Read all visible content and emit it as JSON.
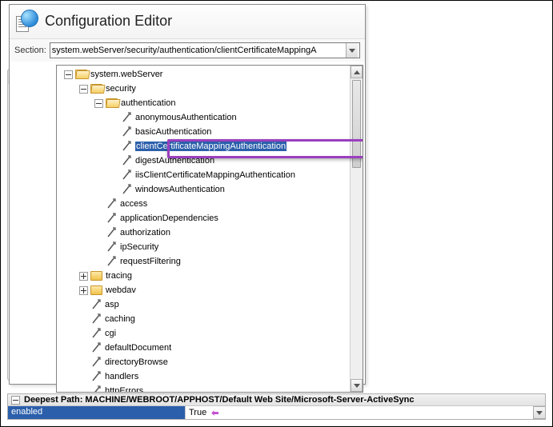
{
  "bg": {
    "title": "Deep",
    "row": "enable"
  },
  "header": {
    "title": "Configuration Editor"
  },
  "section": {
    "label": "Section:",
    "value": "system.webServer/security/authentication/clientCertificateMappingA"
  },
  "tree": [
    {
      "depth": 0,
      "exp": "minus",
      "icon": "folder-open",
      "label": "system.webServer"
    },
    {
      "depth": 1,
      "exp": "minus",
      "icon": "folder-open",
      "label": "security"
    },
    {
      "depth": 2,
      "exp": "minus",
      "icon": "folder-open",
      "label": "authentication"
    },
    {
      "depth": 3,
      "exp": "none",
      "icon": "leaf",
      "label": "anonymousAuthentication"
    },
    {
      "depth": 3,
      "exp": "none",
      "icon": "leaf",
      "label": "basicAuthentication"
    },
    {
      "depth": 3,
      "exp": "none",
      "icon": "leaf",
      "label": "clientCertificateMappingAuthentication",
      "selected": true
    },
    {
      "depth": 3,
      "exp": "none",
      "icon": "leaf",
      "label": "digestAuthentication"
    },
    {
      "depth": 3,
      "exp": "none",
      "icon": "leaf",
      "label": "iisClientCertificateMappingAuthentication"
    },
    {
      "depth": 3,
      "exp": "none",
      "icon": "leaf",
      "label": "windowsAuthentication"
    },
    {
      "depth": 2,
      "exp": "none",
      "icon": "leaf",
      "label": "access"
    },
    {
      "depth": 2,
      "exp": "none",
      "icon": "leaf",
      "label": "applicationDependencies"
    },
    {
      "depth": 2,
      "exp": "none",
      "icon": "leaf",
      "label": "authorization"
    },
    {
      "depth": 2,
      "exp": "none",
      "icon": "leaf",
      "label": "ipSecurity"
    },
    {
      "depth": 2,
      "exp": "none",
      "icon": "leaf",
      "label": "requestFiltering"
    },
    {
      "depth": 1,
      "exp": "plus",
      "icon": "folder",
      "label": "tracing"
    },
    {
      "depth": 1,
      "exp": "plus",
      "icon": "folder",
      "label": "webdav"
    },
    {
      "depth": 1,
      "exp": "none",
      "icon": "leaf",
      "label": "asp"
    },
    {
      "depth": 1,
      "exp": "none",
      "icon": "leaf",
      "label": "caching"
    },
    {
      "depth": 1,
      "exp": "none",
      "icon": "leaf",
      "label": "cgi"
    },
    {
      "depth": 1,
      "exp": "none",
      "icon": "leaf",
      "label": "defaultDocument"
    },
    {
      "depth": 1,
      "exp": "none",
      "icon": "leaf",
      "label": "directoryBrowse"
    },
    {
      "depth": 1,
      "exp": "none",
      "icon": "leaf",
      "label": "handlers"
    },
    {
      "depth": 1,
      "exp": "none",
      "icon": "leaf",
      "label": "httpErrors"
    }
  ],
  "bottom": {
    "headerLabel": "Deepest Path:",
    "headerPath": "MACHINE/WEBROOT/APPHOST/Default Web Site/Microsoft-Server-ActiveSync",
    "key": "enabled",
    "value": "True"
  }
}
